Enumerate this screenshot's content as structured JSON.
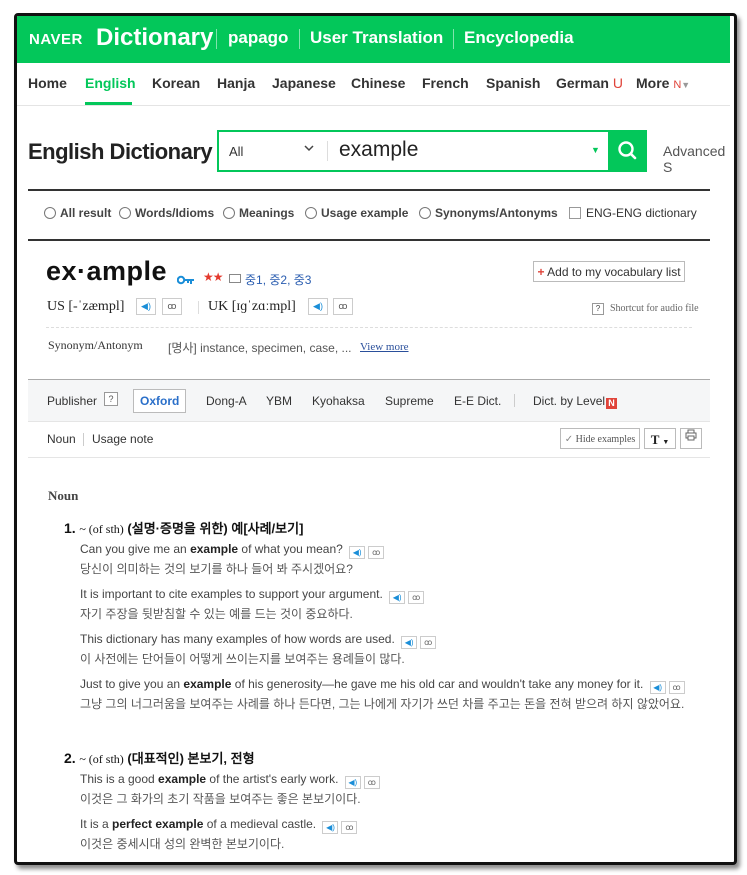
{
  "topbar": {
    "naver": "NAVER",
    "dictionary": "Dictionary",
    "links": [
      "papago",
      "User Translation",
      "Encyclopedia"
    ]
  },
  "nav": {
    "items": [
      "Home",
      "English",
      "Korean",
      "Hanja",
      "Japanese",
      "Chinese",
      "French",
      "Spanish",
      "German",
      "More"
    ],
    "active": "English",
    "german_mark": "U",
    "more_mark": "N"
  },
  "search": {
    "page_title": "English Dictionary",
    "scope": "All",
    "query": "example",
    "advanced": "Advanced S"
  },
  "filters": {
    "radios": [
      "All result",
      "Words/Idioms",
      "Meanings",
      "Usage example",
      "Synonyms/Antonyms"
    ],
    "checkbox": "ENG-ENG dictionary"
  },
  "entry": {
    "headword": "ex·ample",
    "stars": "★★",
    "grades": "중1, 중2, 중3",
    "vocab_button": "Add to my vocabulary list",
    "us_pron": "US [-ˈzæmpl]",
    "uk_pron": "UK [ɪɡˈzɑːmpl]",
    "shortcut": "Shortcut for audio file",
    "synonym_label": "Synonym/Antonym",
    "synonym_text": "[명사] instance, specimen, case, ...",
    "view_more": "View more"
  },
  "publishers": {
    "label": "Publisher",
    "items": [
      "Oxford",
      "Dong-A",
      "YBM",
      "Kyohaksa",
      "Supreme",
      "E-E Dict."
    ],
    "active": "Oxford",
    "by_level": "Dict. by Level"
  },
  "subbar": {
    "noun": "Noun",
    "usage_note": "Usage note",
    "hide_examples": "Hide examples",
    "font_button": "T"
  },
  "content": {
    "pos": "Noun",
    "senses": [
      {
        "num": "1.",
        "gram": "~ (of sth)",
        "def": "(설명·증명을 위한) 예[사례/보기]",
        "examples": [
          {
            "en_pre": "Can you give me an ",
            "en_bold": "example",
            "en_post": " of what you mean?",
            "kr": "당신이 의미하는 것의 보기를 하나 들어 봐 주시겠어요?"
          },
          {
            "en_pre": "It is important to cite examples to support your argument.",
            "en_bold": "",
            "en_post": "",
            "kr": "자기 주장을 뒷받침할 수 있는 예를 드는 것이 중요하다."
          },
          {
            "en_pre": "This dictionary has many examples of how words are used.",
            "en_bold": "",
            "en_post": "",
            "kr": "이 사전에는 단어들이 어떻게 쓰이는지를 보여주는 용례들이 많다."
          },
          {
            "en_pre": "Just to give you an ",
            "en_bold": "example",
            "en_post": " of his generosity—he gave me his old car and wouldn't take any money for it.",
            "kr": "그냥 그의 너그러움을 보여주는 사례를 하나 든다면, 그는 나에게 자기가 쓰던 차를 주고는 돈을 전혀 받으려 하지 않았어요."
          }
        ]
      },
      {
        "num": "2.",
        "gram": "~ (of sth)",
        "def": "(대표적인) 본보기, 전형",
        "examples": [
          {
            "en_pre": "This is a good ",
            "en_bold": "example",
            "en_post": " of the artist's early work.",
            "kr": "이것은 그 화가의 초기 작품을 보여주는 좋은 본보기이다."
          },
          {
            "en_pre": "It is a ",
            "en_bold": "perfect example",
            "en_post": " of a medieval castle.",
            "kr": "이것은 중세시대 성의 완벽한 본보기이다."
          }
        ]
      }
    ]
  }
}
